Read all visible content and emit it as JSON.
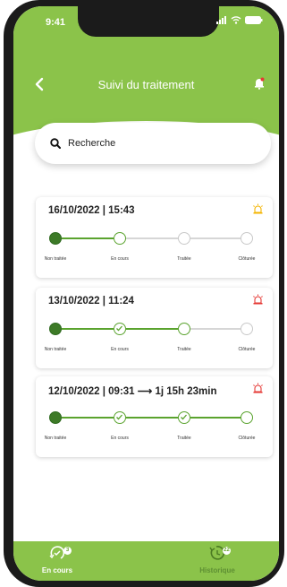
{
  "status": {
    "time": "9:41"
  },
  "header": {
    "title": "Suivi du traitement"
  },
  "search": {
    "placeholder": "Recherche"
  },
  "steps": [
    "Non traitée",
    "En cours",
    "Traitée",
    "Clôturée"
  ],
  "cards": [
    {
      "title": "16/10/2022 | 15:43",
      "alert": "yellow",
      "progress_step": 1
    },
    {
      "title": "13/10/2022 | 11:24",
      "alert": "red",
      "progress_step": 2
    },
    {
      "title": "12/10/2022 | 09:31  ⟶  1j 15h 23min",
      "alert": "red",
      "progress_step": 3
    }
  ],
  "tabs": [
    {
      "label": "En cours",
      "badge": "3",
      "active": true
    },
    {
      "label": "Historique",
      "badge": "22",
      "active": false
    }
  ],
  "colors": {
    "accent": "#8bc34a",
    "green_dark": "#4a8a2a",
    "alert_yellow": "#f4b400",
    "alert_red": "#e53935"
  }
}
